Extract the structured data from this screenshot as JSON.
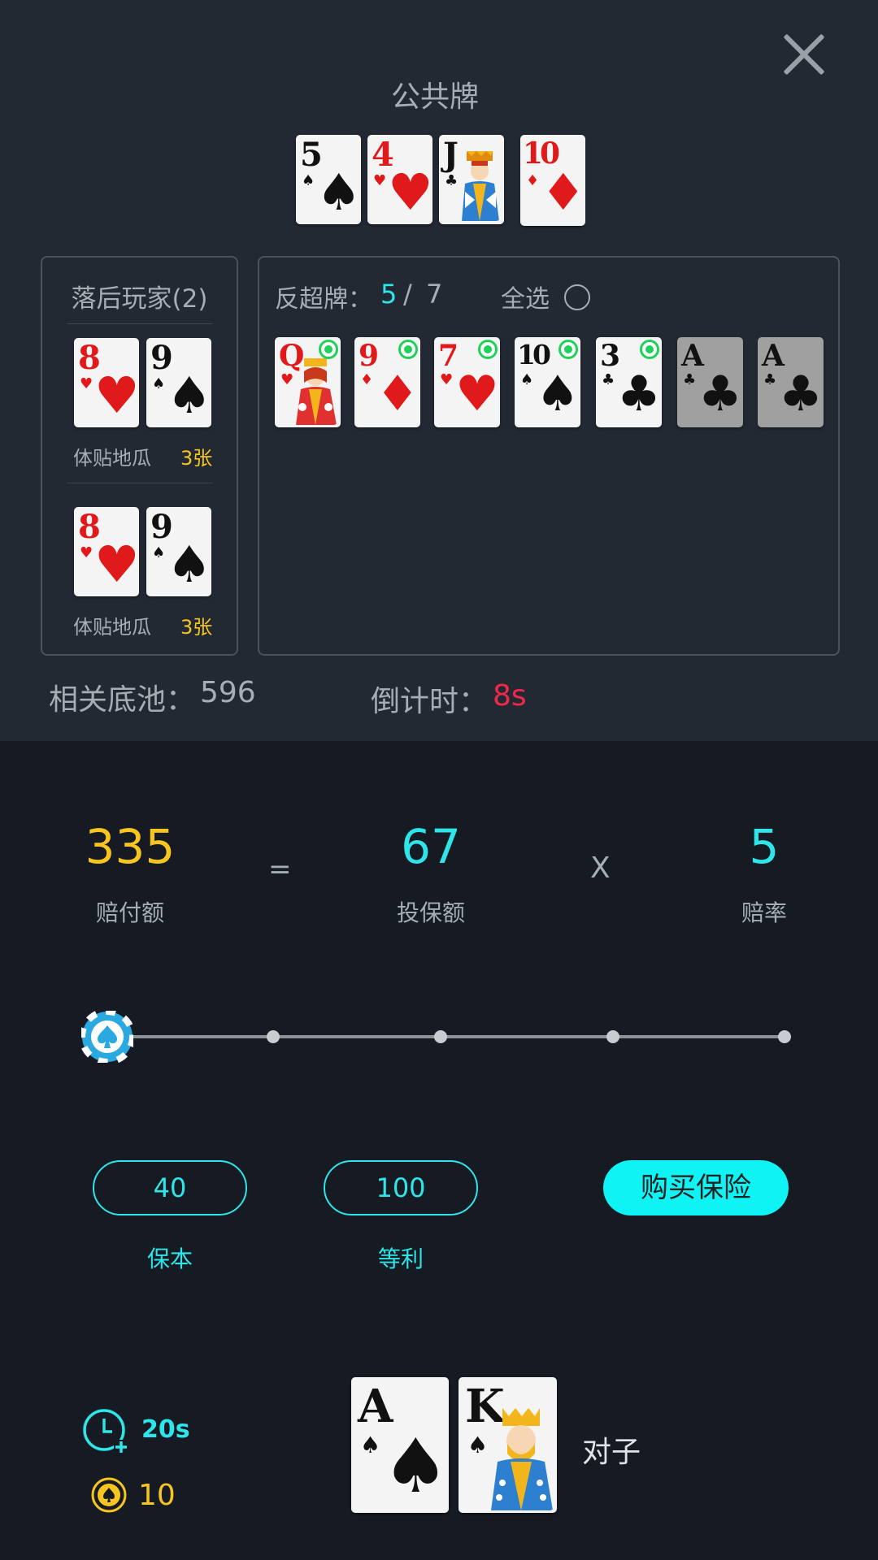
{
  "header": {
    "title": "公共牌",
    "close_icon": "close-icon"
  },
  "community_cards": [
    {
      "rank": "5",
      "suit": "♠",
      "color": "black"
    },
    {
      "rank": "4",
      "suit": "♥",
      "color": "red"
    },
    {
      "rank": "J",
      "suit": "♣",
      "color": "black",
      "face": "jack"
    },
    {
      "rank": "10",
      "suit": "♦",
      "color": "red"
    }
  ],
  "trailing_players": {
    "title": "落后玩家(2)",
    "players": [
      {
        "name": "体贴地瓜",
        "count": "3张",
        "cards": [
          {
            "rank": "8",
            "suit": "♥"
          },
          {
            "rank": "9",
            "suit": "♠"
          }
        ]
      },
      {
        "name": "体贴地瓜",
        "count": "3张",
        "cards": [
          {
            "rank": "8",
            "suit": "♥"
          },
          {
            "rank": "9",
            "suit": "♠"
          }
        ]
      }
    ]
  },
  "outs": {
    "label": "反超牌：",
    "selected": "5",
    "separator": "/",
    "total": "7",
    "select_all": "全选",
    "cards": [
      {
        "rank": "Q",
        "suit": "♥",
        "selected": true
      },
      {
        "rank": "9",
        "suit": "♦",
        "selected": true
      },
      {
        "rank": "7",
        "suit": "♥",
        "selected": true
      },
      {
        "rank": "10",
        "suit": "♠",
        "selected": true
      },
      {
        "rank": "3",
        "suit": "♣",
        "selected": true
      },
      {
        "rank": "A",
        "suit": "♣",
        "selected": false
      },
      {
        "rank": "A",
        "suit": "♣",
        "selected": false
      }
    ]
  },
  "pot": {
    "label": "相关底池：",
    "value": "596"
  },
  "countdown": {
    "label": "倒计时：",
    "value": "8s"
  },
  "formula": {
    "payout": "335",
    "payout_label": "赔付额",
    "equals": "=",
    "premium": "67",
    "premium_label": "投保额",
    "times": "X",
    "odds": "5",
    "odds_label": "赔率"
  },
  "slider": {
    "level": 0,
    "stops": 5,
    "handle_icon": "spade-chip-icon"
  },
  "presets": [
    {
      "value": "40",
      "label": "保本"
    },
    {
      "value": "100",
      "label": "等利"
    }
  ],
  "buy_button": "购买保险",
  "footer": {
    "timer_icon": "clock-plus-icon",
    "time": "20s",
    "coin_icon": "coin-icon",
    "coins": "10",
    "hand": [
      {
        "rank": "A",
        "suit": "♠"
      },
      {
        "rank": "K",
        "suit": "♠",
        "face": "king"
      }
    ],
    "hand_type": "对子"
  },
  "colors": {
    "accent": "#2ee5ea",
    "gold": "#f7c520",
    "alert": "#f0284a",
    "button": "#10f3f5"
  }
}
